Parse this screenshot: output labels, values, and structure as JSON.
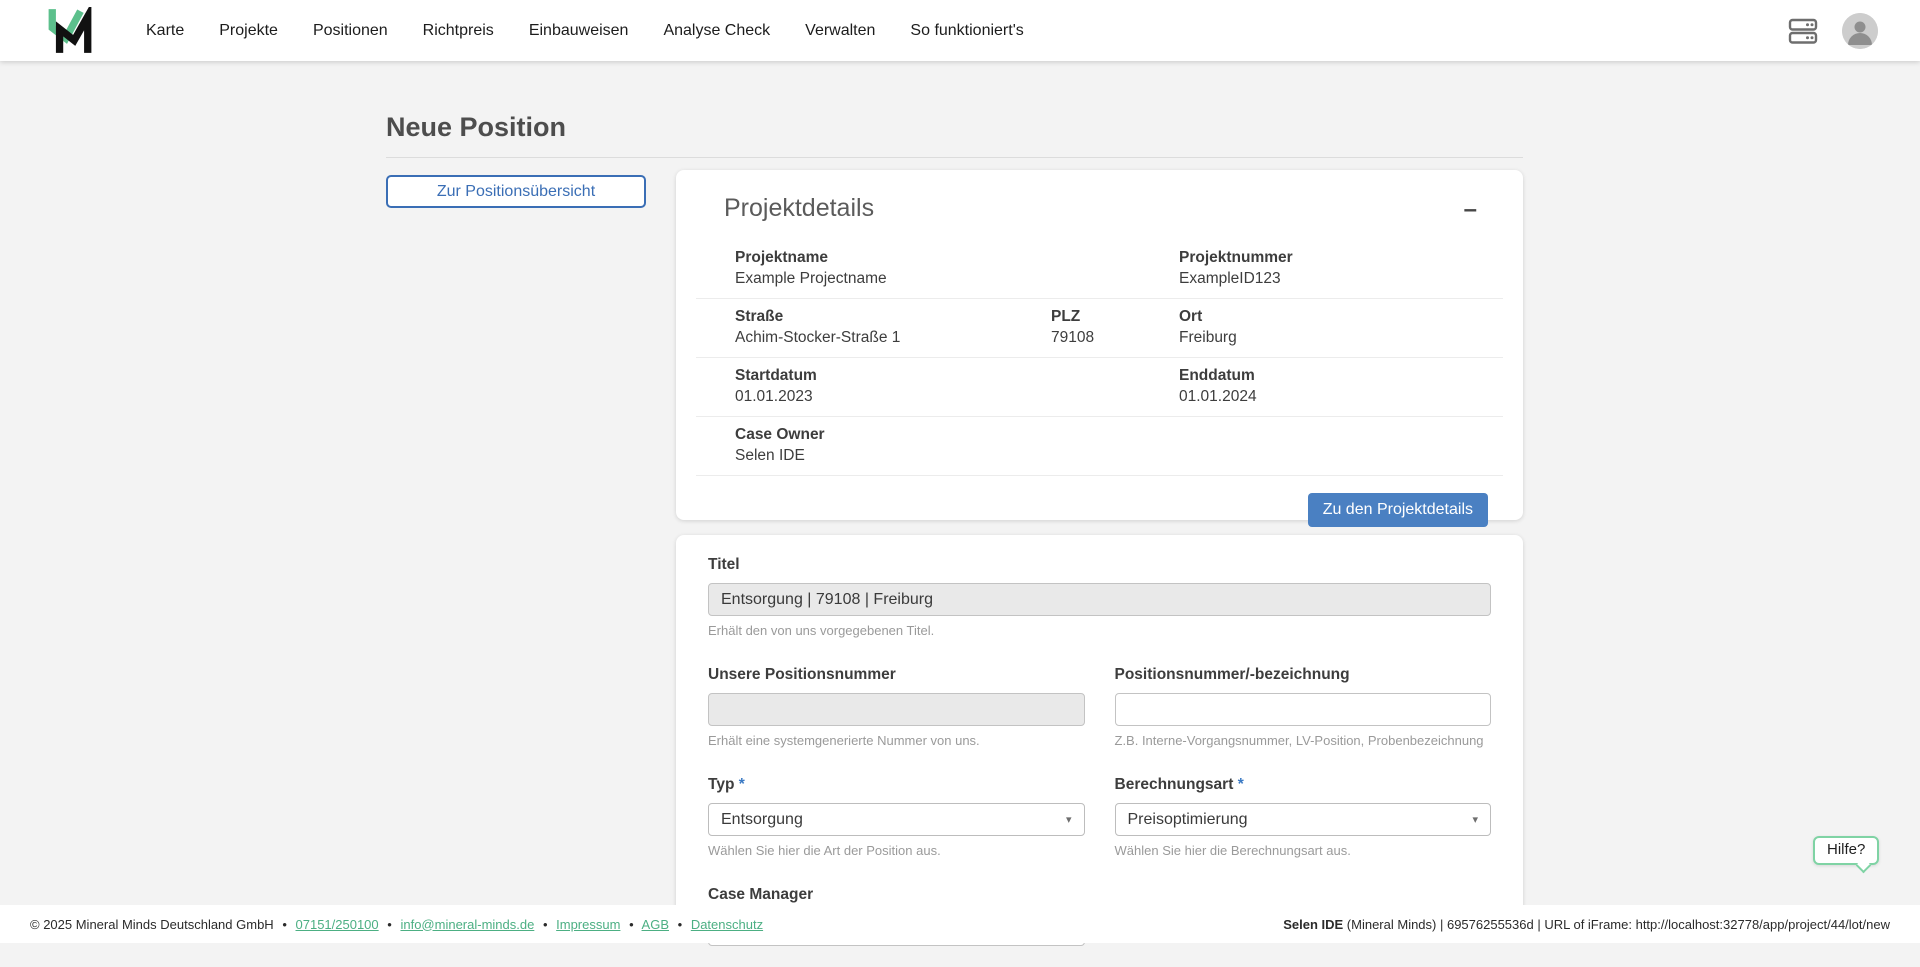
{
  "nav": {
    "items": [
      "Karte",
      "Projekte",
      "Positionen",
      "Richtpreis",
      "Einbauweisen",
      "Analyse Check",
      "Verwalten",
      "So funktioniert's"
    ]
  },
  "page": {
    "title": "Neue Position",
    "overview_button": "Zur Positionsübersicht"
  },
  "project_details": {
    "title": "Projektdetails",
    "collapse_icon": "–",
    "rows": {
      "projektname": {
        "label": "Projektname",
        "value": "Example Projectname"
      },
      "projektnummer": {
        "label": "Projektnummer",
        "value": "ExampleID123"
      },
      "strasse": {
        "label": "Straße",
        "value": "Achim-Stocker-Straße 1"
      },
      "plz": {
        "label": "PLZ",
        "value": "79108"
      },
      "ort": {
        "label": "Ort",
        "value": "Freiburg"
      },
      "startdatum": {
        "label": "Startdatum",
        "value": "01.01.2023"
      },
      "enddatum": {
        "label": "Enddatum",
        "value": "01.01.2024"
      },
      "case_owner": {
        "label": "Case Owner",
        "value": "Selen IDE"
      }
    },
    "action_button": "Zu den Projektdetails"
  },
  "form": {
    "titel": {
      "label": "Titel",
      "value": "Entsorgung | 79108 | Freiburg",
      "helper": "Erhält den von uns vorgegebenen Titel."
    },
    "unsere_positionsnummer": {
      "label": "Unsere Positionsnummer",
      "value": "",
      "helper": "Erhält eine systemgenerierte Nummer von uns."
    },
    "positionsnummer_bezeichnung": {
      "label": "Positionsnummer/-bezeichnung",
      "value": "",
      "helper": "Z.B. Interne-Vorgangsnummer, LV-Position, Probenbezeichnung"
    },
    "typ": {
      "label": "Typ",
      "required_mark": "*",
      "value": "Entsorgung",
      "caret": "▾",
      "helper": "Wählen Sie hier die Art der Position aus."
    },
    "berechnungsart": {
      "label": "Berechnungsart",
      "required_mark": "*",
      "value": "Preisoptimierung",
      "caret": "▾",
      "helper": "Wählen Sie hier die Berechnungsart aus."
    },
    "case_manager": {
      "label": "Case Manager",
      "value": ""
    }
  },
  "help": {
    "label": "Hilfe?"
  },
  "footer": {
    "copyright": "© 2025 Mineral Minds Deutschland GmbH",
    "separator": "•",
    "phone": "07151/250100",
    "email": "info@mineral-minds.de",
    "impressum": "Impressum",
    "agb": "AGB",
    "datenschutz": "Datenschutz",
    "session_user": "Selen IDE",
    "session_rest": " (Mineral Minds) | 69576255536d | URL of iFrame: http://localhost:32778/app/project/44/lot/new"
  },
  "colors": {
    "accent_blue": "#4a80c2",
    "outline_blue": "#3a6eb5",
    "brand_green": "#5cc08c",
    "link_green": "#4caf83"
  }
}
